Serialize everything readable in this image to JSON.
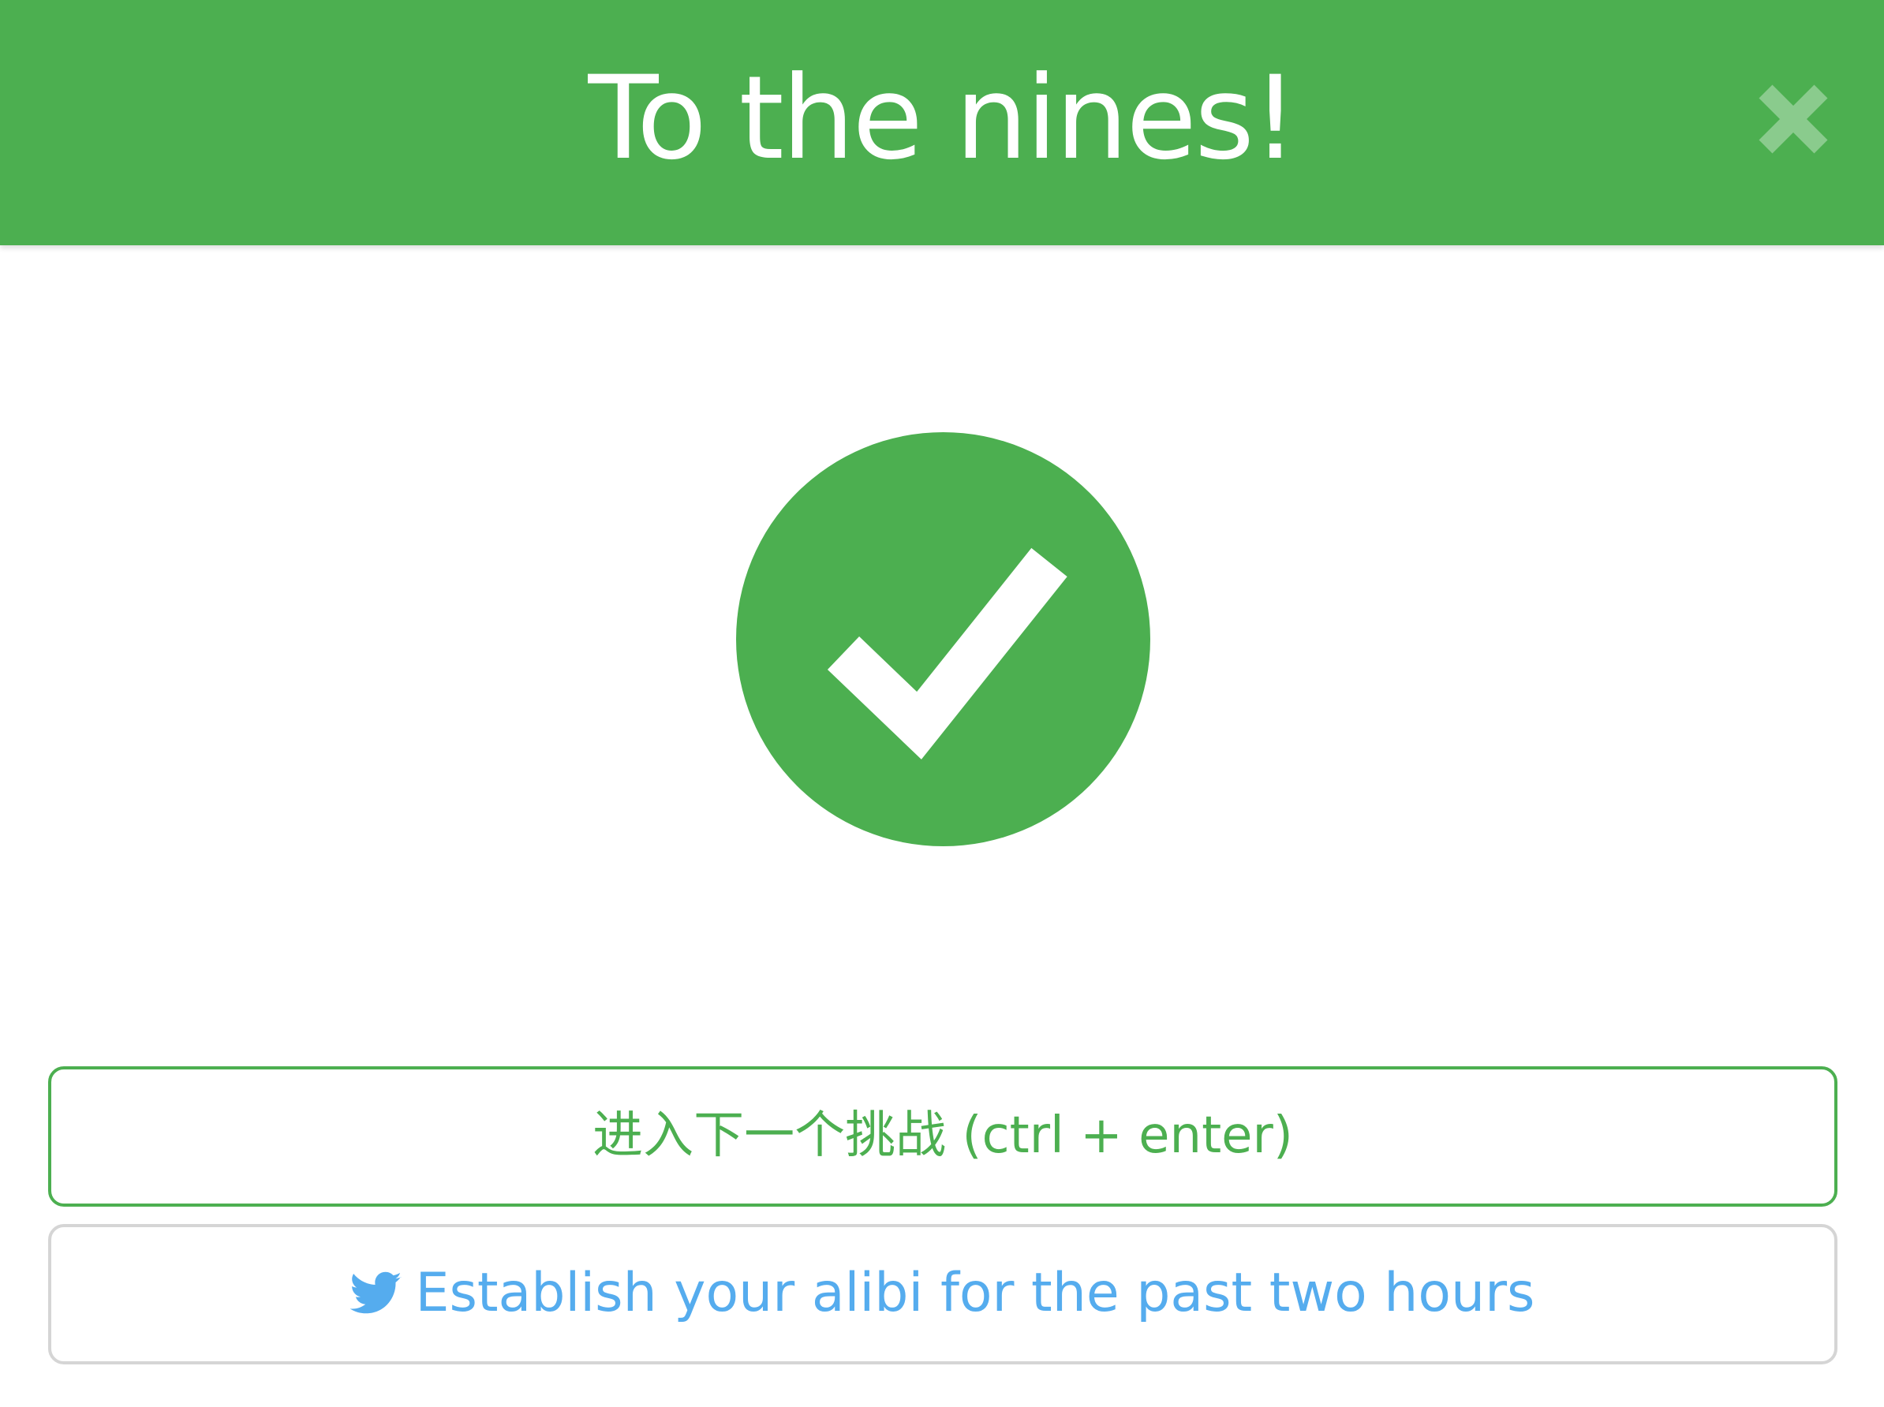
{
  "header": {
    "title": "To the nines!",
    "background_color": "#4caf50",
    "close_icon": "close-icon"
  },
  "success_badge": {
    "icon": "checkmark-icon",
    "color": "#4caf50"
  },
  "actions": {
    "next_challenge_label": "进入下一个挑战 (ctrl + enter)",
    "tweet_label": "Establish your alibi for the past two hours",
    "tweet_icon": "twitter-icon",
    "tweet_color": "#55acee"
  }
}
